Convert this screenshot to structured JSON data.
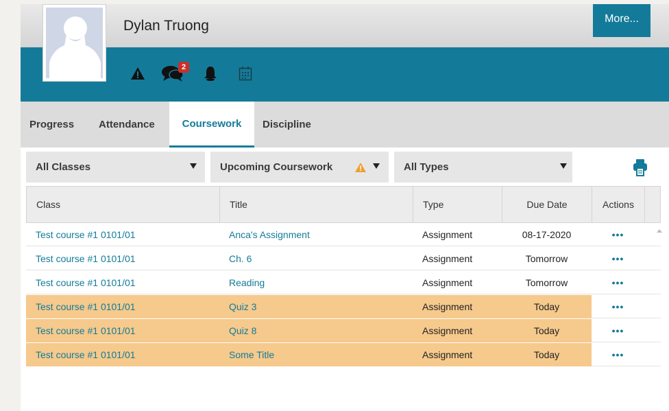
{
  "header": {
    "student_name": "Dylan Truong",
    "more_label": "More...",
    "message_count": "2",
    "icons": [
      "alert-icon",
      "messages-icon",
      "notification-bell-icon",
      "calendar-icon"
    ]
  },
  "tabs": [
    {
      "label": "Progress"
    },
    {
      "label": "Attendance"
    },
    {
      "label": "Coursework",
      "active": true
    },
    {
      "label": "Discipline"
    }
  ],
  "filters": {
    "classes": "All Classes",
    "coursework": "Upcoming Coursework",
    "types": "All Types"
  },
  "table": {
    "columns": [
      "Class",
      "Title",
      "Type",
      "Due Date",
      "Actions"
    ],
    "rows": [
      {
        "class": "Test course #1 0101/01",
        "title": "Anca's Assignment",
        "type": "Assignment",
        "due": "08-17-2020",
        "actions": "•••",
        "highlighted": false
      },
      {
        "class": "Test course #1 0101/01",
        "title": "Ch. 6",
        "type": "Assignment",
        "due": "Tomorrow",
        "actions": "•••",
        "highlighted": false
      },
      {
        "class": "Test course #1 0101/01",
        "title": "Reading",
        "type": "Assignment",
        "due": "Tomorrow",
        "actions": "•••",
        "highlighted": false
      },
      {
        "class": "Test course #1 0101/01",
        "title": "Quiz 3",
        "type": "Assignment",
        "due": "Today",
        "actions": "•••",
        "highlighted": true
      },
      {
        "class": "Test course #1 0101/01",
        "title": "Quiz 8",
        "type": "Assignment",
        "due": "Today",
        "actions": "•••",
        "highlighted": true
      },
      {
        "class": "Test course #1 0101/01",
        "title": "Some Title",
        "type": "Assignment",
        "due": "Today",
        "actions": "•••",
        "highlighted": true
      }
    ]
  },
  "colors": {
    "accent": "#137b99",
    "highlight_row": "#f6c98c",
    "badge": "#c9302c",
    "warning": "#f0a030"
  }
}
